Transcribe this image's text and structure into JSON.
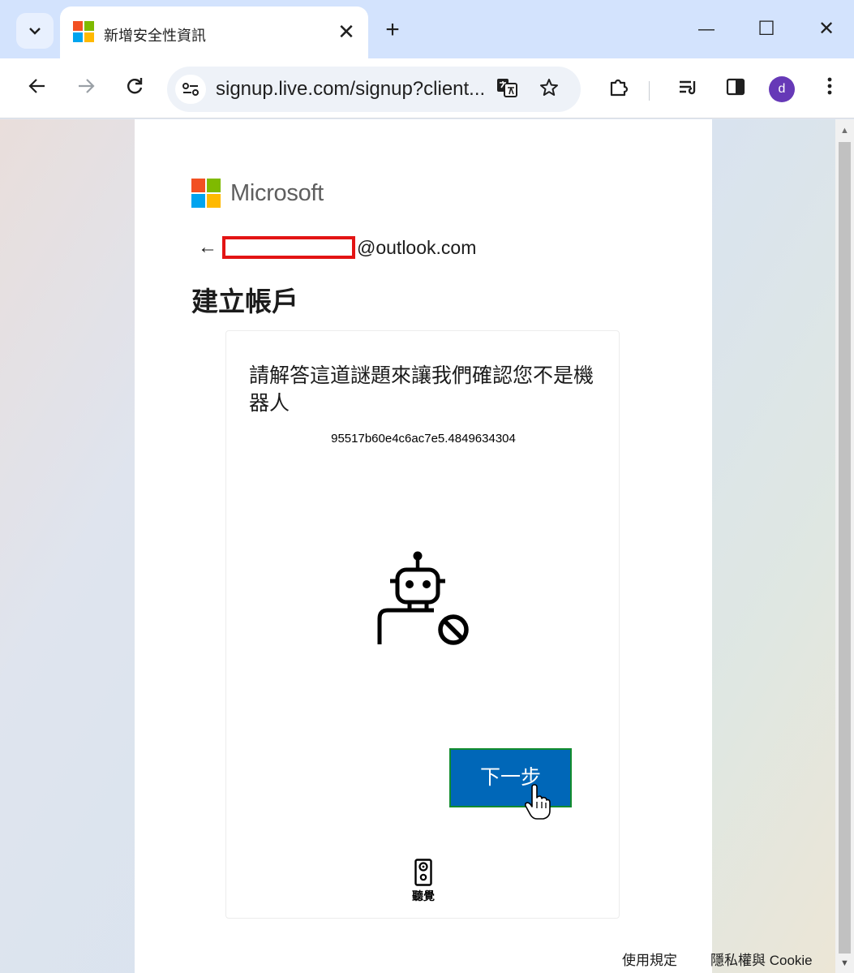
{
  "browser": {
    "tab_title": "新增安全性資訊",
    "close_tab_glyph": "✕",
    "new_tab_glyph": "+",
    "minimize_glyph": "—",
    "maximize_glyph": "☐",
    "close_window_glyph": "✕",
    "url": "signup.live.com/signup?client...",
    "profile_initial": "d"
  },
  "page": {
    "brand": "Microsoft",
    "back_glyph": "←",
    "email_suffix": "@outlook.com",
    "heading": "建立帳戶",
    "puzzle": {
      "prompt": "請解答這道謎題來讓我們確認您不是機器人",
      "session_id": "95517b60e4c6ac7e5.4849634304",
      "next_label": "下一步",
      "audio_label": "聽覺"
    },
    "footer": {
      "terms": "使用規定",
      "privacy": "隱私權與 Cookie"
    }
  },
  "colors": {
    "ms_red": "#f25022",
    "ms_green": "#7fba00",
    "ms_blue": "#00a4ef",
    "ms_yellow": "#ffb900",
    "primary_button": "#0067b8",
    "redaction": "#e31414"
  }
}
